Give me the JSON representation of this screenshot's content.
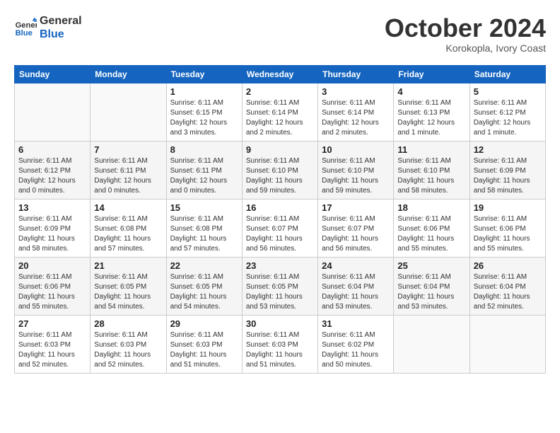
{
  "header": {
    "logo_line1": "General",
    "logo_line2": "Blue",
    "month": "October 2024",
    "location": "Korokopla, Ivory Coast"
  },
  "weekdays": [
    "Sunday",
    "Monday",
    "Tuesday",
    "Wednesday",
    "Thursday",
    "Friday",
    "Saturday"
  ],
  "weeks": [
    [
      {
        "day": "",
        "empty": true
      },
      {
        "day": "",
        "empty": true
      },
      {
        "day": "1",
        "sunrise": "6:11 AM",
        "sunset": "6:15 PM",
        "daylight": "12 hours and 3 minutes."
      },
      {
        "day": "2",
        "sunrise": "6:11 AM",
        "sunset": "6:14 PM",
        "daylight": "12 hours and 2 minutes."
      },
      {
        "day": "3",
        "sunrise": "6:11 AM",
        "sunset": "6:14 PM",
        "daylight": "12 hours and 2 minutes."
      },
      {
        "day": "4",
        "sunrise": "6:11 AM",
        "sunset": "6:13 PM",
        "daylight": "12 hours and 1 minute."
      },
      {
        "day": "5",
        "sunrise": "6:11 AM",
        "sunset": "6:12 PM",
        "daylight": "12 hours and 1 minute."
      }
    ],
    [
      {
        "day": "6",
        "sunrise": "6:11 AM",
        "sunset": "6:12 PM",
        "daylight": "12 hours and 0 minutes."
      },
      {
        "day": "7",
        "sunrise": "6:11 AM",
        "sunset": "6:11 PM",
        "daylight": "12 hours and 0 minutes."
      },
      {
        "day": "8",
        "sunrise": "6:11 AM",
        "sunset": "6:11 PM",
        "daylight": "12 hours and 0 minutes."
      },
      {
        "day": "9",
        "sunrise": "6:11 AM",
        "sunset": "6:10 PM",
        "daylight": "11 hours and 59 minutes."
      },
      {
        "day": "10",
        "sunrise": "6:11 AM",
        "sunset": "6:10 PM",
        "daylight": "11 hours and 59 minutes."
      },
      {
        "day": "11",
        "sunrise": "6:11 AM",
        "sunset": "6:10 PM",
        "daylight": "11 hours and 58 minutes."
      },
      {
        "day": "12",
        "sunrise": "6:11 AM",
        "sunset": "6:09 PM",
        "daylight": "11 hours and 58 minutes."
      }
    ],
    [
      {
        "day": "13",
        "sunrise": "6:11 AM",
        "sunset": "6:09 PM",
        "daylight": "11 hours and 58 minutes."
      },
      {
        "day": "14",
        "sunrise": "6:11 AM",
        "sunset": "6:08 PM",
        "daylight": "11 hours and 57 minutes."
      },
      {
        "day": "15",
        "sunrise": "6:11 AM",
        "sunset": "6:08 PM",
        "daylight": "11 hours and 57 minutes."
      },
      {
        "day": "16",
        "sunrise": "6:11 AM",
        "sunset": "6:07 PM",
        "daylight": "11 hours and 56 minutes."
      },
      {
        "day": "17",
        "sunrise": "6:11 AM",
        "sunset": "6:07 PM",
        "daylight": "11 hours and 56 minutes."
      },
      {
        "day": "18",
        "sunrise": "6:11 AM",
        "sunset": "6:06 PM",
        "daylight": "11 hours and 55 minutes."
      },
      {
        "day": "19",
        "sunrise": "6:11 AM",
        "sunset": "6:06 PM",
        "daylight": "11 hours and 55 minutes."
      }
    ],
    [
      {
        "day": "20",
        "sunrise": "6:11 AM",
        "sunset": "6:06 PM",
        "daylight": "11 hours and 55 minutes."
      },
      {
        "day": "21",
        "sunrise": "6:11 AM",
        "sunset": "6:05 PM",
        "daylight": "11 hours and 54 minutes."
      },
      {
        "day": "22",
        "sunrise": "6:11 AM",
        "sunset": "6:05 PM",
        "daylight": "11 hours and 54 minutes."
      },
      {
        "day": "23",
        "sunrise": "6:11 AM",
        "sunset": "6:05 PM",
        "daylight": "11 hours and 53 minutes."
      },
      {
        "day": "24",
        "sunrise": "6:11 AM",
        "sunset": "6:04 PM",
        "daylight": "11 hours and 53 minutes."
      },
      {
        "day": "25",
        "sunrise": "6:11 AM",
        "sunset": "6:04 PM",
        "daylight": "11 hours and 53 minutes."
      },
      {
        "day": "26",
        "sunrise": "6:11 AM",
        "sunset": "6:04 PM",
        "daylight": "11 hours and 52 minutes."
      }
    ],
    [
      {
        "day": "27",
        "sunrise": "6:11 AM",
        "sunset": "6:03 PM",
        "daylight": "11 hours and 52 minutes."
      },
      {
        "day": "28",
        "sunrise": "6:11 AM",
        "sunset": "6:03 PM",
        "daylight": "11 hours and 52 minutes."
      },
      {
        "day": "29",
        "sunrise": "6:11 AM",
        "sunset": "6:03 PM",
        "daylight": "11 hours and 51 minutes."
      },
      {
        "day": "30",
        "sunrise": "6:11 AM",
        "sunset": "6:03 PM",
        "daylight": "11 hours and 51 minutes."
      },
      {
        "day": "31",
        "sunrise": "6:11 AM",
        "sunset": "6:02 PM",
        "daylight": "11 hours and 50 minutes."
      },
      {
        "day": "",
        "empty": true
      },
      {
        "day": "",
        "empty": true
      }
    ]
  ],
  "labels": {
    "sunrise_prefix": "Sunrise: ",
    "sunset_prefix": "Sunset: ",
    "daylight_prefix": "Daylight: "
  }
}
